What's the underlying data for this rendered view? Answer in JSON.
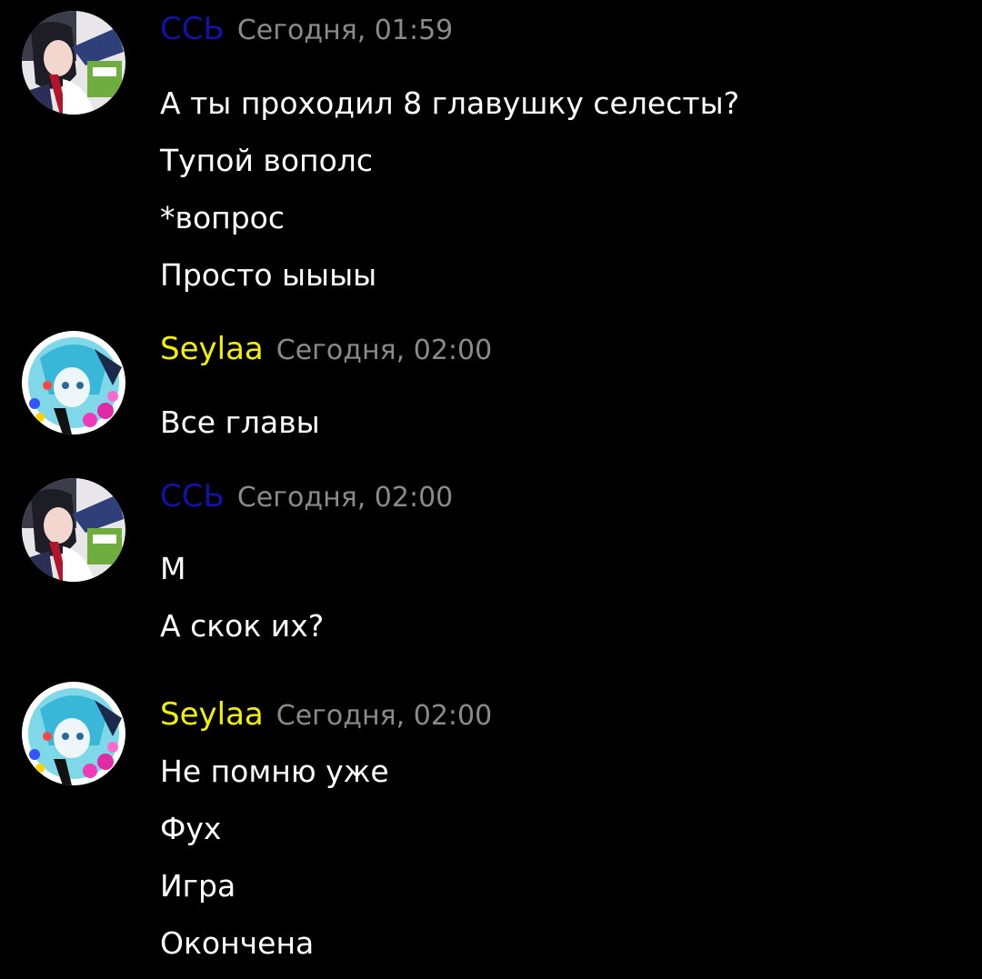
{
  "colors": {
    "background": "#000000",
    "user_css": "#1212a8",
    "user_seylaa": "#f2f200",
    "timestamp": "#8a8a8a",
    "text": "#ffffff"
  },
  "messages": [
    {
      "username": "ССЬ",
      "avatar": "anime-girl-avatar",
      "timestamp": "Сегодня, 01:59",
      "lines": [
        "А ты проходил 8 главушку селесты?",
        "Тупой вополс",
        "*вопрос",
        "Просто ыыыы"
      ]
    },
    {
      "username": "Seylaa",
      "avatar": "colorful-anime-avatar",
      "timestamp": "Сегодня, 02:00",
      "lines": [
        "Все главы"
      ]
    },
    {
      "username": "ССЬ",
      "avatar": "anime-girl-avatar",
      "timestamp": "Сегодня, 02:00",
      "lines": [
        "М",
        "А скок их?"
      ]
    },
    {
      "username": "Seylaa",
      "avatar": "colorful-anime-avatar",
      "timestamp": "Сегодня, 02:00",
      "lines": [
        "Не помню уже",
        "Фух",
        "Игра",
        "Окончена"
      ]
    }
  ]
}
